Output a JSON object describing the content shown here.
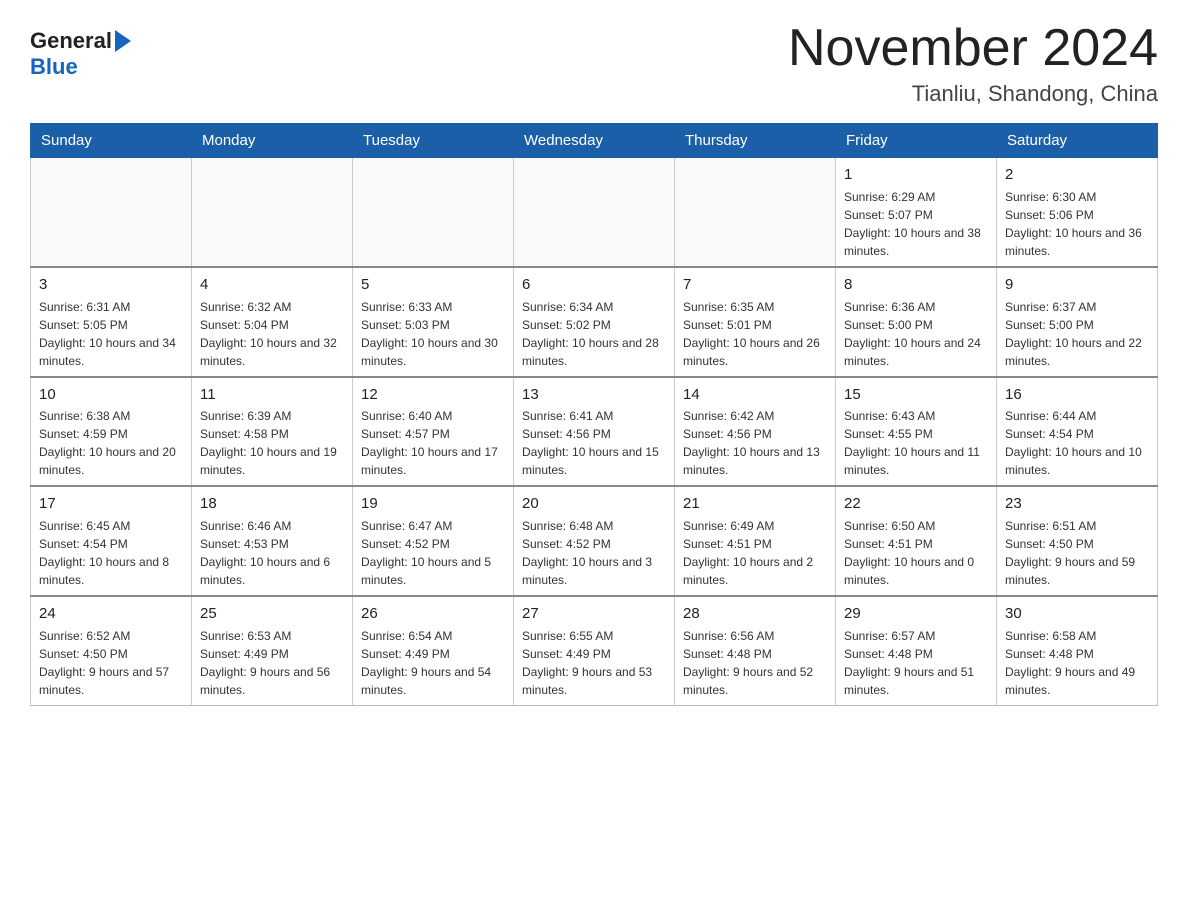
{
  "header": {
    "logo_general": "General",
    "logo_blue": "Blue",
    "month_title": "November 2024",
    "subtitle": "Tianliu, Shandong, China"
  },
  "weekdays": [
    "Sunday",
    "Monday",
    "Tuesday",
    "Wednesday",
    "Thursday",
    "Friday",
    "Saturday"
  ],
  "weeks": [
    [
      {
        "day": "",
        "info": ""
      },
      {
        "day": "",
        "info": ""
      },
      {
        "day": "",
        "info": ""
      },
      {
        "day": "",
        "info": ""
      },
      {
        "day": "",
        "info": ""
      },
      {
        "day": "1",
        "info": "Sunrise: 6:29 AM\nSunset: 5:07 PM\nDaylight: 10 hours and 38 minutes."
      },
      {
        "day": "2",
        "info": "Sunrise: 6:30 AM\nSunset: 5:06 PM\nDaylight: 10 hours and 36 minutes."
      }
    ],
    [
      {
        "day": "3",
        "info": "Sunrise: 6:31 AM\nSunset: 5:05 PM\nDaylight: 10 hours and 34 minutes."
      },
      {
        "day": "4",
        "info": "Sunrise: 6:32 AM\nSunset: 5:04 PM\nDaylight: 10 hours and 32 minutes."
      },
      {
        "day": "5",
        "info": "Sunrise: 6:33 AM\nSunset: 5:03 PM\nDaylight: 10 hours and 30 minutes."
      },
      {
        "day": "6",
        "info": "Sunrise: 6:34 AM\nSunset: 5:02 PM\nDaylight: 10 hours and 28 minutes."
      },
      {
        "day": "7",
        "info": "Sunrise: 6:35 AM\nSunset: 5:01 PM\nDaylight: 10 hours and 26 minutes."
      },
      {
        "day": "8",
        "info": "Sunrise: 6:36 AM\nSunset: 5:00 PM\nDaylight: 10 hours and 24 minutes."
      },
      {
        "day": "9",
        "info": "Sunrise: 6:37 AM\nSunset: 5:00 PM\nDaylight: 10 hours and 22 minutes."
      }
    ],
    [
      {
        "day": "10",
        "info": "Sunrise: 6:38 AM\nSunset: 4:59 PM\nDaylight: 10 hours and 20 minutes."
      },
      {
        "day": "11",
        "info": "Sunrise: 6:39 AM\nSunset: 4:58 PM\nDaylight: 10 hours and 19 minutes."
      },
      {
        "day": "12",
        "info": "Sunrise: 6:40 AM\nSunset: 4:57 PM\nDaylight: 10 hours and 17 minutes."
      },
      {
        "day": "13",
        "info": "Sunrise: 6:41 AM\nSunset: 4:56 PM\nDaylight: 10 hours and 15 minutes."
      },
      {
        "day": "14",
        "info": "Sunrise: 6:42 AM\nSunset: 4:56 PM\nDaylight: 10 hours and 13 minutes."
      },
      {
        "day": "15",
        "info": "Sunrise: 6:43 AM\nSunset: 4:55 PM\nDaylight: 10 hours and 11 minutes."
      },
      {
        "day": "16",
        "info": "Sunrise: 6:44 AM\nSunset: 4:54 PM\nDaylight: 10 hours and 10 minutes."
      }
    ],
    [
      {
        "day": "17",
        "info": "Sunrise: 6:45 AM\nSunset: 4:54 PM\nDaylight: 10 hours and 8 minutes."
      },
      {
        "day": "18",
        "info": "Sunrise: 6:46 AM\nSunset: 4:53 PM\nDaylight: 10 hours and 6 minutes."
      },
      {
        "day": "19",
        "info": "Sunrise: 6:47 AM\nSunset: 4:52 PM\nDaylight: 10 hours and 5 minutes."
      },
      {
        "day": "20",
        "info": "Sunrise: 6:48 AM\nSunset: 4:52 PM\nDaylight: 10 hours and 3 minutes."
      },
      {
        "day": "21",
        "info": "Sunrise: 6:49 AM\nSunset: 4:51 PM\nDaylight: 10 hours and 2 minutes."
      },
      {
        "day": "22",
        "info": "Sunrise: 6:50 AM\nSunset: 4:51 PM\nDaylight: 10 hours and 0 minutes."
      },
      {
        "day": "23",
        "info": "Sunrise: 6:51 AM\nSunset: 4:50 PM\nDaylight: 9 hours and 59 minutes."
      }
    ],
    [
      {
        "day": "24",
        "info": "Sunrise: 6:52 AM\nSunset: 4:50 PM\nDaylight: 9 hours and 57 minutes."
      },
      {
        "day": "25",
        "info": "Sunrise: 6:53 AM\nSunset: 4:49 PM\nDaylight: 9 hours and 56 minutes."
      },
      {
        "day": "26",
        "info": "Sunrise: 6:54 AM\nSunset: 4:49 PM\nDaylight: 9 hours and 54 minutes."
      },
      {
        "day": "27",
        "info": "Sunrise: 6:55 AM\nSunset: 4:49 PM\nDaylight: 9 hours and 53 minutes."
      },
      {
        "day": "28",
        "info": "Sunrise: 6:56 AM\nSunset: 4:48 PM\nDaylight: 9 hours and 52 minutes."
      },
      {
        "day": "29",
        "info": "Sunrise: 6:57 AM\nSunset: 4:48 PM\nDaylight: 9 hours and 51 minutes."
      },
      {
        "day": "30",
        "info": "Sunrise: 6:58 AM\nSunset: 4:48 PM\nDaylight: 9 hours and 49 minutes."
      }
    ]
  ]
}
